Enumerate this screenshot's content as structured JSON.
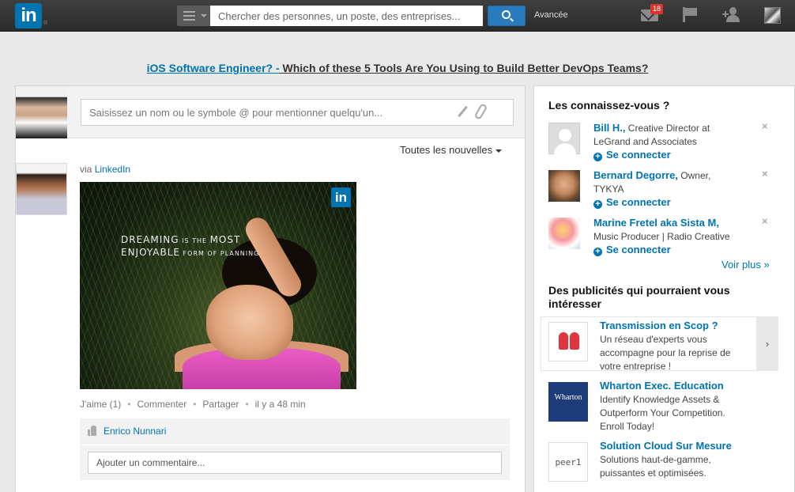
{
  "topbar": {
    "logo_text": "in",
    "search_placeholder": "Chercher des personnes, un poste, des entreprises...",
    "advanced_label": "Avancée",
    "messages_count": "18",
    "icons": [
      "menu-icon",
      "search-icon",
      "mail-icon",
      "flag-icon",
      "add-connection-icon",
      "avatar"
    ]
  },
  "banner": {
    "part1": "iOS Software Engineer? -",
    "part2": " Which of these 5 Tools Are You Using to Build Better DevOps Teams?"
  },
  "share": {
    "placeholder": "Saisissez un nom ou le symbole @ pour mentionner quelqu'un..."
  },
  "feed": {
    "filter_label": "Toutes les nouvelles",
    "post": {
      "via_prefix": "via",
      "via_source": "LinkedIn",
      "image_caption_big1": "DREAMING",
      "image_caption_small1": " IS THE ",
      "image_caption_big2": "MOST",
      "image_caption_big3": "ENJOYABLE",
      "image_caption_small2": " FORM OF PLANNING",
      "image_logo": "in",
      "actions": {
        "like": "J'aime (1)",
        "comment": "Commenter",
        "share": "Partager",
        "time": "il y a 48 min",
        "separator": "•"
      },
      "liker": "Enrico Nunnari",
      "comment_placeholder": "Ajouter un commentaire..."
    }
  },
  "sidebar": {
    "pymk_title": "Les connaissez-vous ?",
    "people": [
      {
        "name": "Bill H.,",
        "headline_1": "Creative Director at",
        "headline_2": "LeGrand and Associates",
        "connect": "Se connecter",
        "close": "×"
      },
      {
        "name": "Bernard Degorre,",
        "headline_1": "Owner,",
        "headline_2": "TYKYA",
        "connect": "Se connecter",
        "close": "×"
      },
      {
        "name": "Marine Fretel aka Sista M,",
        "headline_1": "",
        "headline_2": "Music Producer | Radio Creative",
        "connect": "Se connecter",
        "close": "×"
      }
    ],
    "see_more": "Voir plus »",
    "ads_title_1": "Des publicités qui pourraient vous",
    "ads_title_2": "intéresser",
    "ads": [
      {
        "title": "Transmission en Scop ?",
        "l1": "Un réseau d'experts vous",
        "l2": "accompagne pour la reprise de",
        "l3": "votre entreprise !"
      },
      {
        "title": "Wharton Exec. Education",
        "logo_text": "Wharton",
        "l1": "Identify Knowledge Assets &",
        "l2": "Outperform Your Competition.",
        "l3": "Enroll Today!"
      },
      {
        "title": "Solution Cloud Sur Mesure",
        "logo_text": "peer1",
        "l1": "Solutions haut-de-gamme,",
        "l2": "puissantes et optimisées.",
        "l3": ""
      }
    ],
    "ad_arrow": "›"
  }
}
